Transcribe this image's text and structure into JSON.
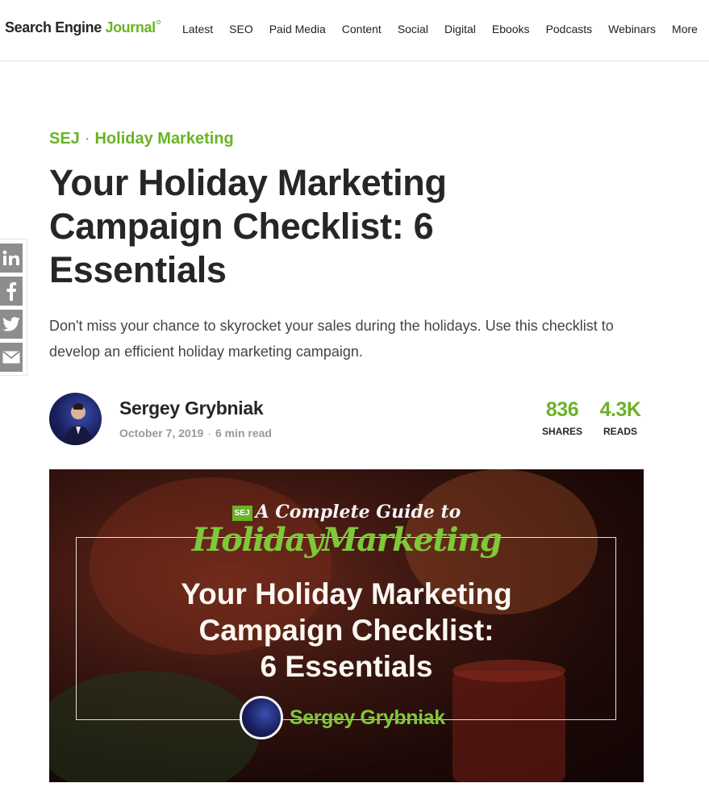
{
  "site": {
    "logo_main": "Search Engine ",
    "logo_accent": "Journal"
  },
  "nav": {
    "items": [
      "Latest",
      "SEO",
      "Paid Media",
      "Content",
      "Social",
      "Digital",
      "Ebooks",
      "Podcasts",
      "Webinars",
      "More"
    ]
  },
  "share": {
    "icons": [
      "linkedin-icon",
      "facebook-icon",
      "twitter-icon",
      "email-icon"
    ]
  },
  "article": {
    "breadcrumb": {
      "site": "SEJ",
      "separator": "·",
      "category": "Holiday Marketing"
    },
    "title": "Your Holiday Marketing Campaign Checklist: 6 Essentials",
    "dek": "Don't miss your chance to skyrocket your sales during the holidays. Use this checklist to develop an efficient holiday marketing campaign.",
    "author": "Sergey Grybniak",
    "date": "October 7, 2019",
    "meta_separator": "·",
    "read_time": "6 min read",
    "stats": {
      "shares_value": "836",
      "shares_label": "SHARES",
      "reads_value": "4.3K",
      "reads_label": "READS"
    }
  },
  "hero": {
    "badge": "SEJ",
    "kicker": "A Complete Guide to",
    "series": "HolidayMarketing",
    "title": "Your Holiday Marketing\nCampaign Checklist:\n6 Essentials",
    "author": "Sergey Grybniak"
  },
  "colors": {
    "accent": "#69b324",
    "text": "#262626",
    "muted": "#999999",
    "share_button": "#8d8d8d"
  }
}
